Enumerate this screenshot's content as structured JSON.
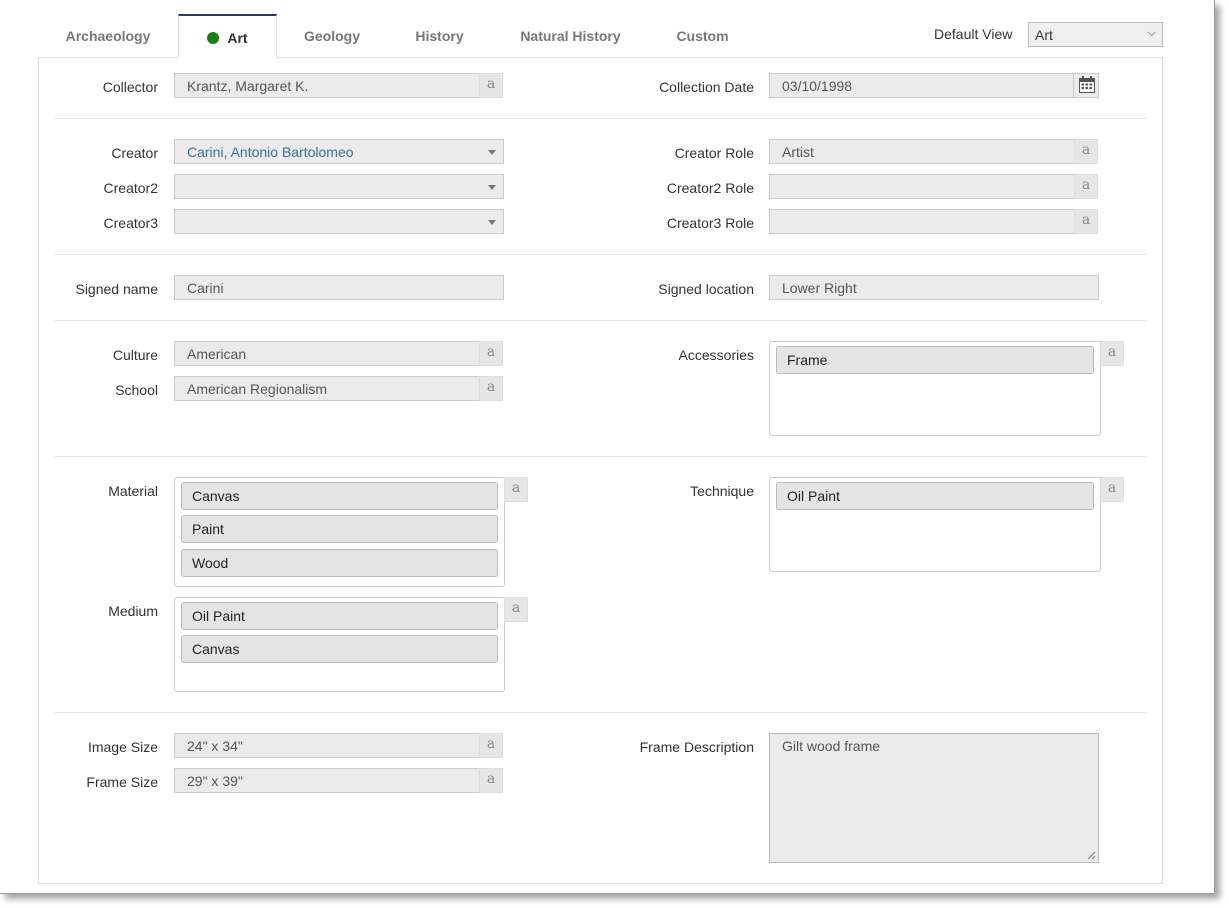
{
  "tabs": [
    {
      "label": "Archaeology"
    },
    {
      "label": "Art"
    },
    {
      "label": "Geology"
    },
    {
      "label": "History"
    },
    {
      "label": "Natural History"
    },
    {
      "label": "Custom"
    }
  ],
  "active_tab": "Art",
  "active_dot_color": "#1b7e1b",
  "default_view": {
    "label": "Default View",
    "value": "Art"
  },
  "collector": {
    "label": "Collector",
    "value": "Krantz, Margaret K."
  },
  "collection_date": {
    "label": "Collection Date",
    "value": "03/10/1998"
  },
  "creators": [
    {
      "label": "Creator",
      "value": "Carini, Antonio Bartolomeo",
      "role_label": "Creator Role",
      "role_value": "Artist"
    },
    {
      "label": "Creator2",
      "value": "",
      "role_label": "Creator2 Role",
      "role_value": ""
    },
    {
      "label": "Creator3",
      "value": "",
      "role_label": "Creator3 Role",
      "role_value": ""
    }
  ],
  "signed_name": {
    "label": "Signed name",
    "value": "Carini"
  },
  "signed_location": {
    "label": "Signed location",
    "value": "Lower Right"
  },
  "culture": {
    "label": "Culture",
    "value": "American"
  },
  "school": {
    "label": "School",
    "value": "American Regionalism"
  },
  "accessories": {
    "label": "Accessories",
    "items": [
      "Frame"
    ]
  },
  "material": {
    "label": "Material",
    "items": [
      "Canvas",
      "Paint",
      "Wood"
    ]
  },
  "technique": {
    "label": "Technique",
    "items": [
      "Oil Paint"
    ]
  },
  "medium": {
    "label": "Medium",
    "items": [
      "Oil Paint",
      "Canvas"
    ]
  },
  "image_size": {
    "label": "Image Size",
    "value": "24\" x 34\""
  },
  "frame_size": {
    "label": "Frame Size",
    "value": "29\" x 39\""
  },
  "frame_description": {
    "label": "Frame Description",
    "value": "Gilt wood frame"
  },
  "alpha_button_glyph": "a"
}
